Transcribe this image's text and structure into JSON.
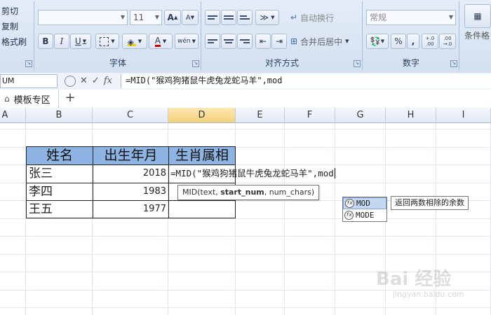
{
  "ribbon": {
    "clipboard": {
      "cut": "剪切",
      "copy": "复制",
      "format_painter": "格式刷"
    },
    "font": {
      "label": "字体",
      "font_name": "",
      "font_size": "11",
      "grow": "A",
      "shrink": "A",
      "bold": "B",
      "italic": "I",
      "underline": "U",
      "font_color": "A",
      "phonetic": "wén"
    },
    "alignment": {
      "label": "对齐方式",
      "wrap_text": "自动换行",
      "merge_center": "合并后居中"
    },
    "number": {
      "label": "数字",
      "format": "常规",
      "percent": "%",
      "comma": ",",
      "inc_decimal": "+.0 .00",
      "dec_decimal": ".00 →.0"
    },
    "styles": {
      "conditional_format": "条件格"
    }
  },
  "formula_bar": {
    "name_box": "UM",
    "cancel": "✕",
    "confirm": "✓",
    "fx": "fx",
    "formula": "=MID(\"猴鸡狗猪鼠牛虎兔龙蛇马羊\",mod"
  },
  "tabs": {
    "doc_tab": "模板专区",
    "add": "+"
  },
  "columns": [
    "A",
    "B",
    "C",
    "D",
    "E",
    "F",
    "G",
    "H",
    "I"
  ],
  "table": {
    "headers": [
      "姓名",
      "出生年月",
      "生肖属相"
    ],
    "rows": [
      {
        "name": "张三",
        "year": "2018",
        "zodiac": "=MID(\"猴鸡狗猪鼠牛虎兔龙蛇马羊\",mod"
      },
      {
        "name": "李四",
        "year": "1983",
        "zodiac": ""
      },
      {
        "name": "王五",
        "year": "1977",
        "zodiac": ""
      }
    ]
  },
  "syntax_tip": {
    "func": "MID(text, ",
    "bold_arg": "start_num",
    "rest": ", num_chars)"
  },
  "autocomplete": {
    "items": [
      "MOD",
      "MODE"
    ],
    "description": "返回两数相除的余数"
  },
  "watermark": {
    "logo": "Bai 经验",
    "url": "jingyan.baidu.com"
  }
}
